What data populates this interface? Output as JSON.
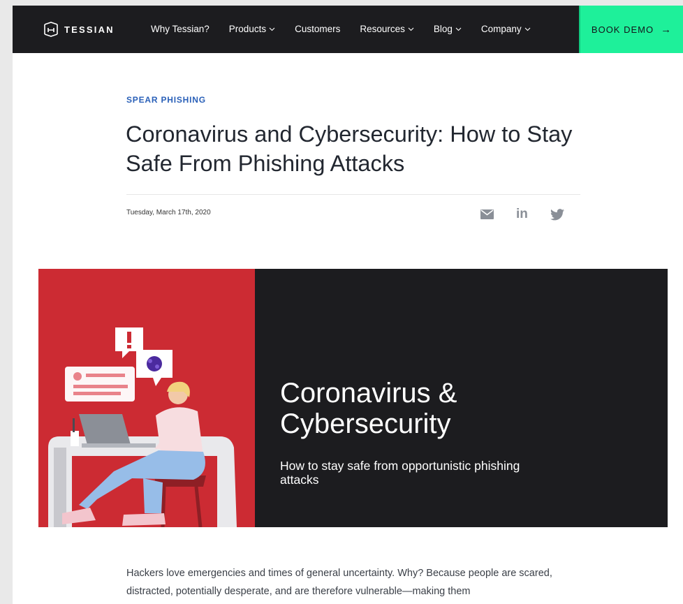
{
  "nav": {
    "logo_text": "TESSIAN",
    "links": [
      {
        "label": "Why Tessian?",
        "dropdown": false
      },
      {
        "label": "Products",
        "dropdown": true
      },
      {
        "label": "Customers",
        "dropdown": false
      },
      {
        "label": "Resources",
        "dropdown": true
      },
      {
        "label": "Blog",
        "dropdown": true
      },
      {
        "label": "Company",
        "dropdown": true
      }
    ],
    "cta_label": "BOOK DEMO",
    "cta_icon": "arrow-right-icon"
  },
  "article": {
    "category": "SPEAR PHISHING",
    "title": "Coronavirus and Cybersecurity: How to Stay Safe From Phishing Attacks",
    "date": "Tuesday, March 17th, 2020",
    "share": [
      "mail-icon",
      "linkedin-icon",
      "twitter-icon"
    ],
    "share_linkedin_text": "in",
    "hero": {
      "heading": "Coronavirus & Cybersecurity",
      "subheading": "How to stay safe from opportunistic phishing attacks"
    },
    "body": "Hackers love emergencies and times of general uncertainty. Why? Because people are scared, distracted, potentially desperate, and are therefore vulnerable—making them"
  },
  "colors": {
    "nav_bg": "#1c1c1f",
    "cta_bg": "#1ef09a",
    "category": "#2a60b8",
    "hero_red": "#cc2b33",
    "hero_dark": "#1c1c1f"
  }
}
